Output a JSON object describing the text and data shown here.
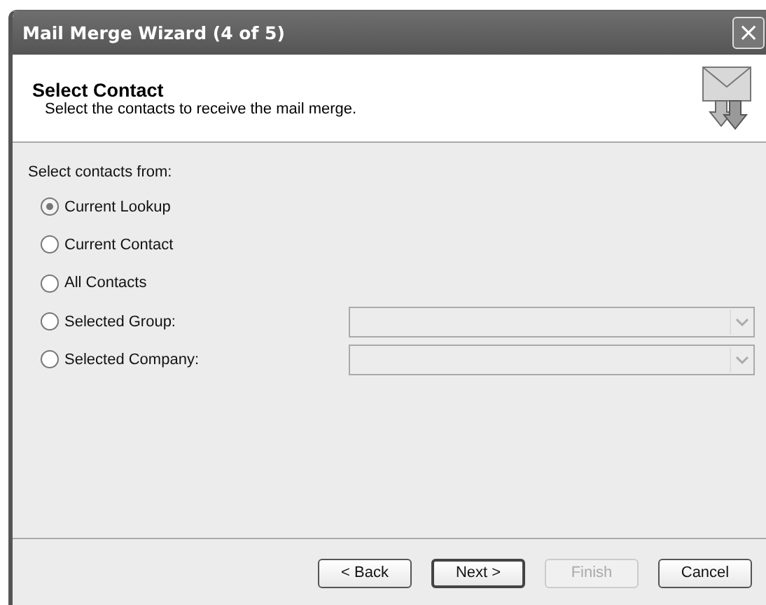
{
  "window": {
    "title": "Mail Merge Wizard (4 of 5)",
    "close": "×"
  },
  "header": {
    "title": "Select Contact",
    "subtitle": "Select the contacts to receive the mail merge."
  },
  "group_label": "Select contacts from:",
  "options": [
    {
      "label": "Current Lookup",
      "selected": true,
      "kind": "plain"
    },
    {
      "label": "Current Contact",
      "selected": false,
      "kind": "plain"
    },
    {
      "label": "All Contacts",
      "selected": false,
      "kind": "plain"
    },
    {
      "label": "Selected Group:",
      "selected": false,
      "kind": "dropdown",
      "dropdown_disabled": true
    },
    {
      "label": "Selected Company:",
      "selected": false,
      "kind": "dropdown",
      "dropdown_disabled": true
    }
  ],
  "buttons": [
    {
      "label": "< Back",
      "disabled": false,
      "default": false
    },
    {
      "label": "Next >",
      "disabled": false,
      "default": true
    },
    {
      "label": "Finish",
      "disabled": true,
      "default": false
    },
    {
      "label": "Cancel",
      "disabled": false,
      "default": false
    }
  ]
}
